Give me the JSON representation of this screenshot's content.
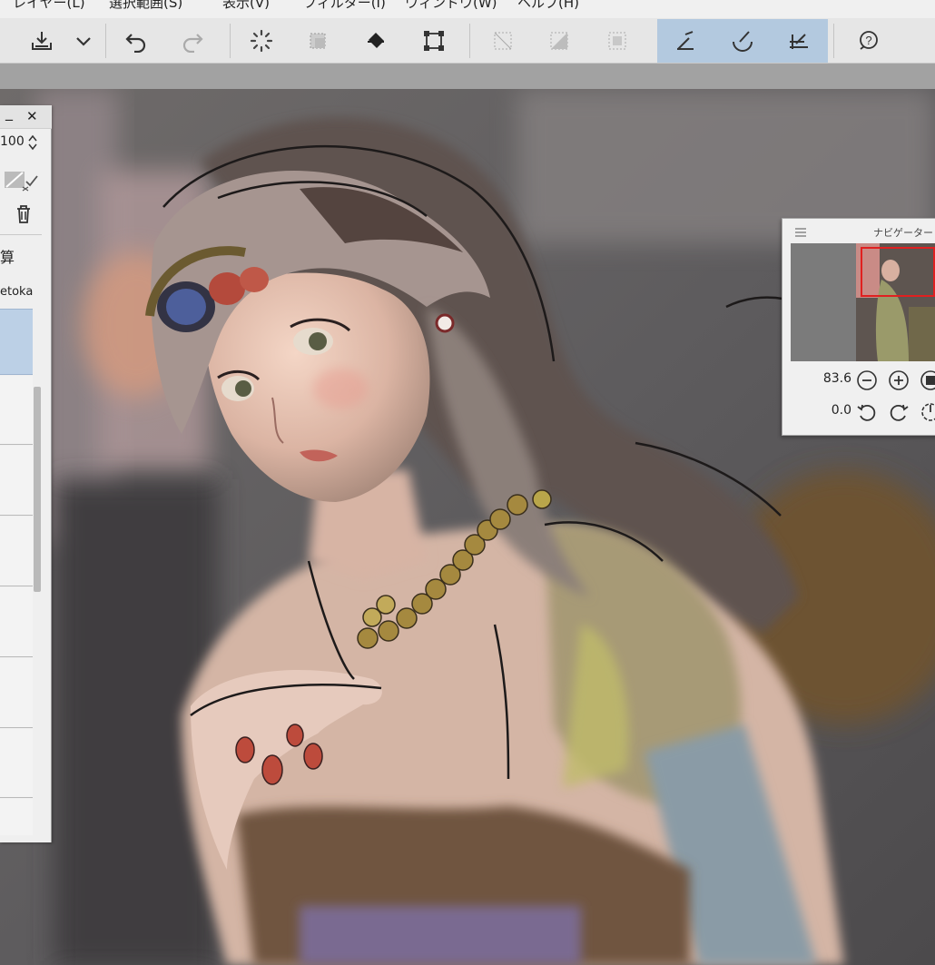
{
  "menu": {
    "items": [
      "レイヤー(L)",
      "選択範囲(S)",
      "表示(V)",
      "フィルター(I)",
      "ウィンドウ(W)",
      "ヘルプ(H)"
    ]
  },
  "toolbar": {
    "tools": [
      {
        "name": "import-icon"
      },
      {
        "name": "chevron-down-icon"
      },
      {
        "name": "undo-icon"
      },
      {
        "name": "redo-icon"
      },
      {
        "name": "loading-spinner-icon"
      },
      {
        "name": "select-transform-icon"
      },
      {
        "name": "fill-bucket-icon"
      },
      {
        "name": "crop-frame-icon"
      },
      {
        "name": "deselect-icon"
      },
      {
        "name": "invert-selection-icon"
      },
      {
        "name": "border-selection-icon"
      },
      {
        "name": "snap-ruler-icon"
      },
      {
        "name": "snap-curve-icon"
      },
      {
        "name": "snap-grid-icon"
      },
      {
        "name": "help-icon"
      }
    ],
    "accent_color": "#b3c9df"
  },
  "layer_panel": {
    "opacity_value": "100",
    "blend_label": "算",
    "layer_name_fragment": "etoka",
    "selected_row_color": "#bcd0e6"
  },
  "navigator": {
    "title": "ナビゲーター",
    "zoom_value": "83.6",
    "rotation_value": "0.0"
  }
}
